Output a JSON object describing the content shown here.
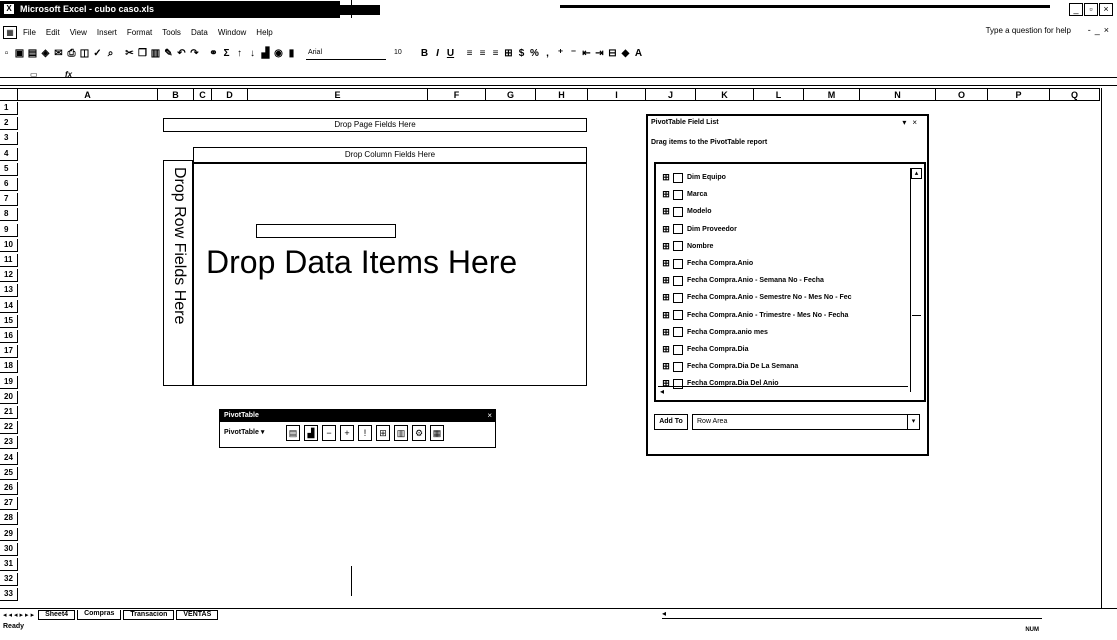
{
  "window": {
    "title": "Microsoft Excel - cubo caso.xls",
    "app_icon": "excel-icon"
  },
  "menu": {
    "items": [
      "File",
      "Edit",
      "View",
      "Insert",
      "Format",
      "Tools",
      "Data",
      "Window",
      "Help"
    ],
    "help_placeholder": "Type a question for help"
  },
  "toolbar": {
    "font_name": "Arial",
    "font_size": "10"
  },
  "columns": [
    "A",
    "B",
    "C",
    "D",
    "E",
    "F",
    "G",
    "H",
    "I",
    "J",
    "K",
    "L",
    "M",
    "N",
    "O",
    "P",
    "Q"
  ],
  "rows": [
    "1",
    "2",
    "3",
    "4",
    "5",
    "6",
    "7",
    "8",
    "9",
    "10",
    "11",
    "12",
    "13",
    "14",
    "15",
    "16",
    "17",
    "18",
    "19",
    "20",
    "21",
    "22",
    "23",
    "24",
    "25",
    "26",
    "27",
    "28",
    "29",
    "30",
    "31",
    "32",
    "33"
  ],
  "pivot": {
    "page_fields": "Drop Page Fields Here",
    "column_fields": "Drop Column Fields Here",
    "row_fields": "Drop Row Fields Here",
    "data_items": "Drop Data Items Here"
  },
  "pivot_toolbar": {
    "title": "PivotTable",
    "menu_label": "PivotTable ▾"
  },
  "field_list": {
    "title": "PivotTable Field List",
    "instructions": "Drag items to the PivotTable report",
    "fields": [
      "Dim Equipo",
      "Marca",
      "Modelo",
      "Dim Proveedor",
      "Nombre",
      "Fecha Compra.Anio",
      "Fecha Compra.Anio - Semana No - Fecha",
      "Fecha Compra.Anio - Semestre No - Mes No - Fec",
      "Fecha Compra.Anio - Trimestre - Mes No - Fecha",
      "Fecha Compra.anio mes",
      "Fecha Compra.Dia",
      "Fecha Compra.Dia De La Semana",
      "Fecha Compra.Dia Del Anio"
    ],
    "add_button": "Add To",
    "area_select": "Row Area"
  },
  "sheets": {
    "tabs": [
      "Sheet4",
      "Compras",
      "Transacion",
      "VENTAS"
    ],
    "active": "Compras"
  },
  "status": {
    "text": "Ready",
    "indicator": "NUM"
  }
}
